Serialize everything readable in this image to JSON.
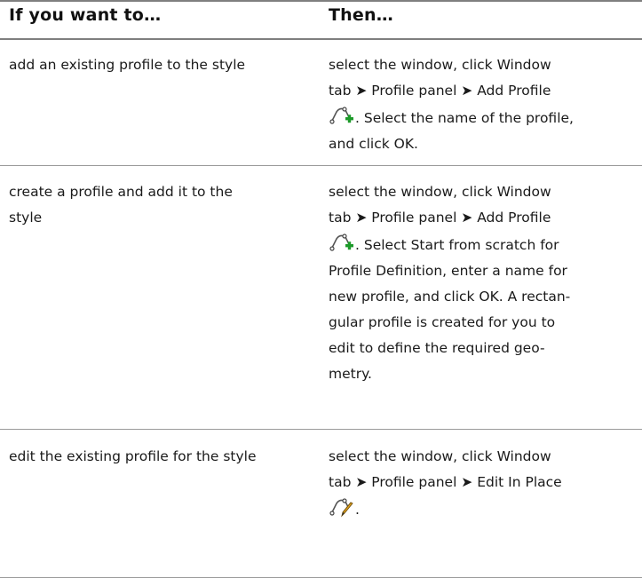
{
  "header": {
    "col_left": "If you want to…",
    "col_right": "Then…"
  },
  "rows": [
    {
      "left": [
        "add an existing profile to the style"
      ],
      "right": [
        "select the window, click Window",
        "tab ➤ Profile panel ➤ Add Profile",
        ". Select the name of the profile,",
        "and click OK."
      ],
      "icon": "add-profile-icon"
    },
    {
      "left": [
        "create a profile and add it to the",
        "style"
      ],
      "right": [
        "select the window, click Window",
        "tab ➤ Profile panel ➤ Add Profile",
        ". Select Start from scratch for",
        "Profile Definition, enter a name for",
        "new profile, and click OK. A rectan-",
        "gular profile is created for you to",
        "edit to define the required geo-",
        "metry."
      ],
      "icon": "add-profile-icon"
    },
    {
      "left": [
        "edit the existing profile for the style"
      ],
      "right": [
        "select the window, click Window",
        "tab ➤ Profile panel ➤ Edit In Place",
        "."
      ],
      "icon": "edit-in-place-icon"
    }
  ]
}
